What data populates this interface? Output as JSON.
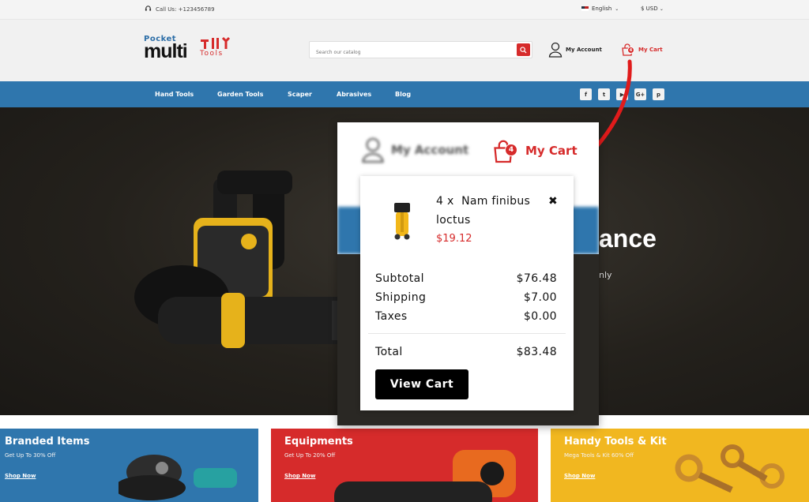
{
  "topbar": {
    "call_label": "Call Us: +123456789",
    "language": "English",
    "currency": "$ USD"
  },
  "header": {
    "logo": {
      "pocket": "Pocket",
      "multi": "multi",
      "tools": "Tools"
    },
    "search_placeholder": "Search our catalog",
    "account_label": "My Account",
    "cart_label": "My Cart",
    "cart_count": "4"
  },
  "nav": {
    "items": [
      "Hand Tools",
      "Garden Tools",
      "Scaper",
      "Abrasives",
      "Blog"
    ],
    "social": [
      "f",
      "t",
      "▶",
      "G+",
      "p"
    ]
  },
  "hero": {
    "heading_fragment": "ance",
    "subtext_fragment": "nly"
  },
  "banners": [
    {
      "title": "Branded Items",
      "subtitle": "Get Up To 30% Off",
      "link": "Shop Now",
      "color": "#2f76ad"
    },
    {
      "title": "Equipments",
      "subtitle": "Get Up To 20% Off",
      "link": "Shop Now",
      "color": "#d62b2b"
    },
    {
      "title": "Handy Tools & Kit",
      "subtitle": "Mega Tools & Kit 60% Off",
      "link": "Shop Now",
      "color": "#f1b720"
    }
  ],
  "popup": {
    "account_label": "My Account",
    "cart_label": "My Cart",
    "cart_count": "4",
    "item": {
      "qty": "4 x",
      "name": "Nam finibus loctus",
      "price": "$19.12"
    },
    "summary": [
      {
        "label": "Subtotal",
        "value": "$76.48"
      },
      {
        "label": "Shipping",
        "value": "$7.00"
      },
      {
        "label": "Taxes",
        "value": "$0.00"
      }
    ],
    "total_label": "Total",
    "total_value": "$83.48",
    "view_cart_label": "View Cart"
  },
  "colors": {
    "brand_red": "#d62b2b",
    "brand_blue": "#2f76ad",
    "banner_yellow": "#f1b720"
  }
}
